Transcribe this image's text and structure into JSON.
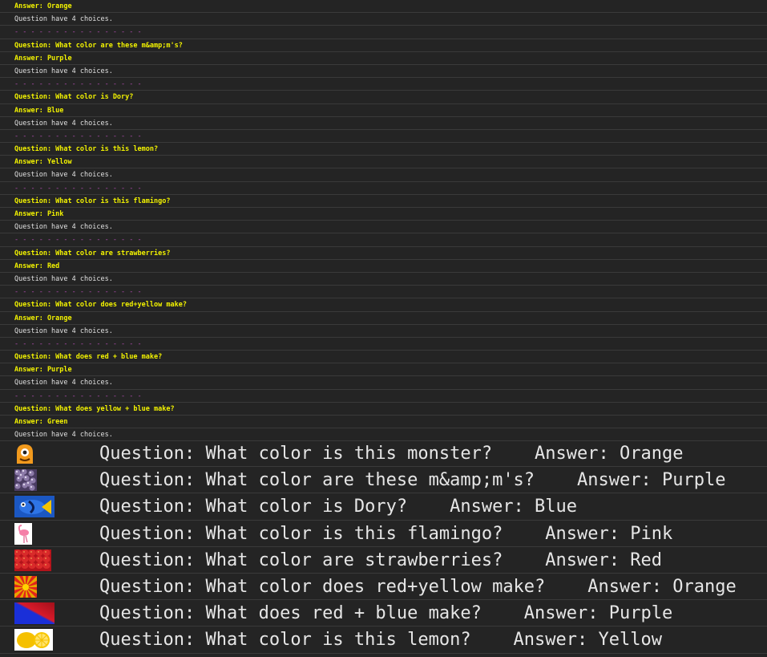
{
  "console": {
    "lines": [
      {
        "kind": "a",
        "text": "Answer: Orange"
      },
      {
        "kind": "c",
        "text": "Question have 4 choices."
      },
      {
        "kind": "sep",
        "text": "- - - - - - - - - - - - - - - -"
      },
      {
        "kind": "q",
        "text": "Question: What color are these m&amp;m's?"
      },
      {
        "kind": "a",
        "text": "Answer: Purple"
      },
      {
        "kind": "c",
        "text": "Question have 4 choices."
      },
      {
        "kind": "sep",
        "text": "- - - - - - - - - - - - - - - -"
      },
      {
        "kind": "q",
        "text": "Question: What color is Dory?"
      },
      {
        "kind": "a",
        "text": "Answer: Blue"
      },
      {
        "kind": "c",
        "text": "Question have 4 choices."
      },
      {
        "kind": "sep",
        "text": "- - - - - - - - - - - - - - - -"
      },
      {
        "kind": "q",
        "text": "Question: What color is this lemon?"
      },
      {
        "kind": "a",
        "text": "Answer: Yellow"
      },
      {
        "kind": "c",
        "text": "Question have 4 choices."
      },
      {
        "kind": "sep",
        "text": "- - - - - - - - - - - - - - - -"
      },
      {
        "kind": "q",
        "text": "Question: What color is this flamingo?"
      },
      {
        "kind": "a",
        "text": "Answer: Pink"
      },
      {
        "kind": "c",
        "text": "Question have 4 choices."
      },
      {
        "kind": "sep",
        "text": "- - - - - - - - - - - - - - - -"
      },
      {
        "kind": "q",
        "text": "Question: What color are strawberries?"
      },
      {
        "kind": "a",
        "text": "Answer: Red"
      },
      {
        "kind": "c",
        "text": "Question have 4 choices."
      },
      {
        "kind": "sep",
        "text": "- - - - - - - - - - - - - - - -"
      },
      {
        "kind": "q",
        "text": "Question: What color does red+yellow make?"
      },
      {
        "kind": "a",
        "text": "Answer: Orange"
      },
      {
        "kind": "c",
        "text": "Question have 4 choices."
      },
      {
        "kind": "sep",
        "text": "- - - - - - - - - - - - - - - -"
      },
      {
        "kind": "q",
        "text": "Question: What does red + blue make?"
      },
      {
        "kind": "a",
        "text": "Answer: Purple"
      },
      {
        "kind": "c",
        "text": "Question have 4 choices."
      },
      {
        "kind": "sep",
        "text": "- - - - - - - - - - - - - - - -"
      },
      {
        "kind": "q",
        "text": "Question: What does yellow + blue make?"
      },
      {
        "kind": "a",
        "text": "Answer: Green"
      },
      {
        "kind": "c",
        "text": "Question have 4 choices."
      }
    ]
  },
  "table": {
    "rows": [
      {
        "image": "monster-image",
        "text": "Question: What color is this monster?    Answer: Orange"
      },
      {
        "image": "mms-image",
        "text": "Question: What color are these m&amp;m's?    Answer: Purple"
      },
      {
        "image": "dory-image",
        "text": "Question: What color is Dory?    Answer: Blue"
      },
      {
        "image": "flamingo-image",
        "text": "Question: What color is this flamingo?    Answer: Pink"
      },
      {
        "image": "strawberries-image",
        "text": "Question: What color are strawberries?    Answer: Red"
      },
      {
        "image": "sunburst-image",
        "text": "Question: What color does red+yellow make?    Answer: Orange"
      },
      {
        "image": "red-blue-image",
        "text": "Question: What does red + blue make?    Answer: Purple"
      },
      {
        "image": "lemon-image",
        "text": "Question: What color is this lemon?    Answer: Yellow"
      }
    ]
  },
  "colors": {
    "background": "#242424",
    "question": "#f2f200",
    "separator": "#b14db1",
    "text": "#e6e6e6"
  }
}
